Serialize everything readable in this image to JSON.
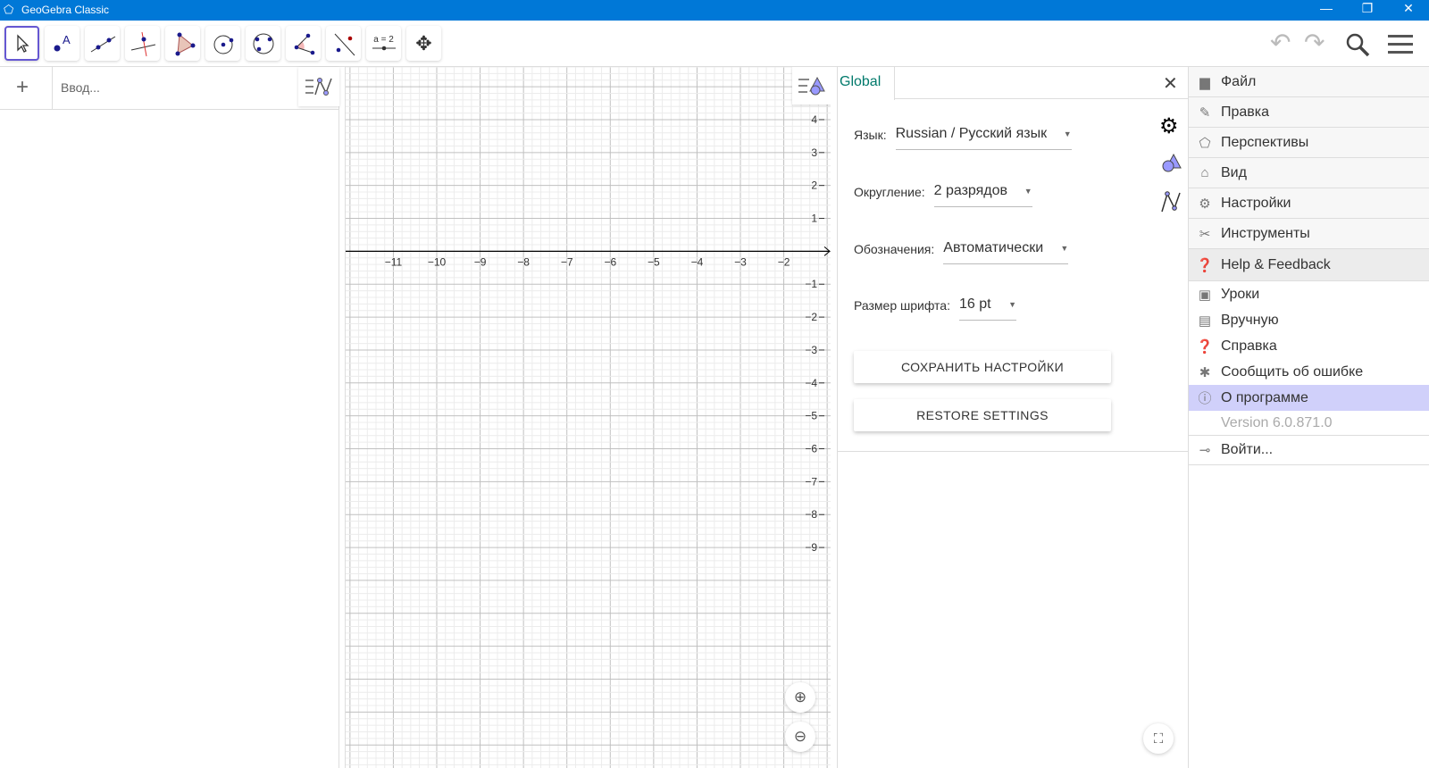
{
  "window": {
    "title": "GeoGebra Classic",
    "minimize": "—",
    "restore": "❐",
    "close": "✕"
  },
  "toolbar": {
    "tools": [
      {
        "name": "move",
        "label": ""
      },
      {
        "name": "point",
        "label": "A"
      },
      {
        "name": "line",
        "label": ""
      },
      {
        "name": "perpendicular",
        "label": ""
      },
      {
        "name": "polygon",
        "label": ""
      },
      {
        "name": "circle-center",
        "label": ""
      },
      {
        "name": "circle-3-points",
        "label": ""
      },
      {
        "name": "angle",
        "label": ""
      },
      {
        "name": "reflect",
        "label": ""
      },
      {
        "name": "slider",
        "label": "a = 2"
      },
      {
        "name": "move-graphics",
        "label": ""
      }
    ],
    "selected": "move"
  },
  "algebra": {
    "add": "+",
    "input_placeholder": "Ввод..."
  },
  "graphics": {
    "chart_data": {
      "type": "grid",
      "x_ticks": [
        -11,
        -10,
        -9,
        -8,
        -7,
        -6,
        -5,
        -4,
        -3,
        -2
      ],
      "y_ticks": [
        4,
        3,
        2,
        1,
        -1,
        -2,
        -3,
        -4,
        -5,
        -6,
        -7,
        -8,
        -9
      ],
      "xlim": [
        -12.1,
        -0.9
      ],
      "ylim": [
        -15.7,
        5.6
      ],
      "grid": true
    }
  },
  "settings": {
    "tab": "Global",
    "rows": [
      {
        "label": "Язык:",
        "value": "Russian / Русский язык"
      },
      {
        "label": "Округление:",
        "value": "2 разрядов"
      },
      {
        "label": "Обозначения:",
        "value": "Автоматически"
      },
      {
        "label": "Размер шрифта:",
        "value": "16 pt"
      }
    ],
    "save": "СОХРАНИТЬ НАСТРОЙКИ",
    "restore": "RESTORE SETTINGS"
  },
  "menu": {
    "items": [
      {
        "label": "Файл",
        "icon": "file"
      },
      {
        "label": "Правка",
        "icon": "pencil"
      },
      {
        "label": "Перспективы",
        "icon": "perspectives"
      },
      {
        "label": "Вид",
        "icon": "home"
      },
      {
        "label": "Настройки",
        "icon": "gear"
      },
      {
        "label": "Инструменты",
        "icon": "tools"
      },
      {
        "label": "Help & Feedback",
        "icon": "help"
      }
    ],
    "sub": [
      {
        "label": "Уроки",
        "icon": "tutorials"
      },
      {
        "label": "Вручную",
        "icon": "manual"
      },
      {
        "label": "Справка",
        "icon": "help"
      },
      {
        "label": "Сообщить об ошибке",
        "icon": "bug"
      },
      {
        "label": "О программе",
        "icon": "info"
      }
    ],
    "version": "Version 6.0.871.0",
    "signin": "Войти...",
    "highlight": "#d0d0fa"
  }
}
